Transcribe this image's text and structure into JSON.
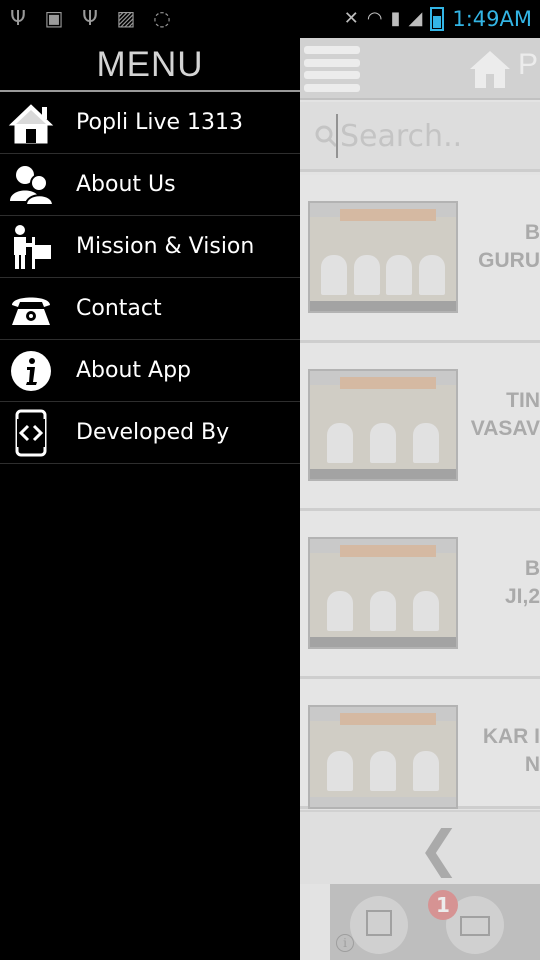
{
  "status_bar": {
    "time": "1:49AM",
    "left_icons": [
      "usb-icon",
      "android-icon",
      "usb-icon",
      "image-icon",
      "whatsapp-icon"
    ],
    "right_icons": [
      "mute-icon",
      "wifi-icon",
      "signal-icon",
      "signal-icon",
      "battery-icon"
    ],
    "accent_color": "#33b5e5"
  },
  "drawer": {
    "title": "MENU",
    "items": [
      {
        "label": "Popli Live 1313",
        "icon": "home-icon"
      },
      {
        "label": "About Us",
        "icon": "users-icon"
      },
      {
        "label": "Mission & Vision",
        "icon": "mission-flag-icon"
      },
      {
        "label": "Contact",
        "icon": "phone-icon"
      },
      {
        "label": "About App",
        "icon": "info-icon"
      },
      {
        "label": "Developed By",
        "icon": "code-device-icon"
      }
    ]
  },
  "app": {
    "title_partial": "P",
    "search": {
      "placeholder": "Search.."
    },
    "cards": [
      {
        "title": "B\nGURU"
      },
      {
        "title": "TIN\nVASAV"
      },
      {
        "title": "B\nJI,2"
      },
      {
        "title": "KAR I\nN"
      }
    ],
    "notification_badge": "1"
  }
}
